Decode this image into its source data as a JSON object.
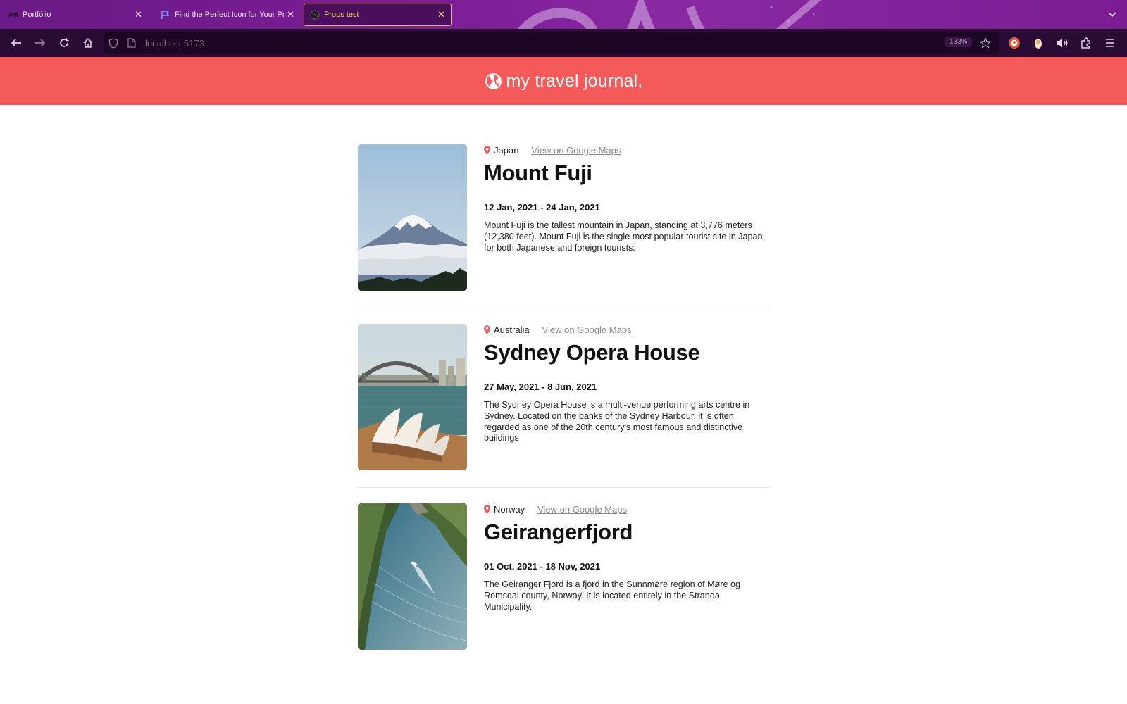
{
  "browser": {
    "tabs": [
      {
        "label": "Portfólio",
        "icon": "site-logo-icon",
        "active": false
      },
      {
        "label": "Find the Perfect Icon for Your Pr",
        "icon": "flag-icon",
        "active": false
      },
      {
        "label": "Props test",
        "icon": "globe-icon",
        "active": true
      }
    ],
    "url": {
      "host": "localhost",
      "port": ":5173"
    },
    "zoom": "133%",
    "accent": "#f6d56a"
  },
  "header": {
    "title": "my travel journal.",
    "icon": "globe-icon",
    "color": "#f55a5a"
  },
  "entries": [
    {
      "country": "Japan",
      "maps_label": "View on Google Maps",
      "title": "Mount Fuji",
      "dates": "12 Jan, 2021 - 24 Jan, 2021",
      "description": "Mount Fuji is the tallest mountain in Japan, standing at 3,776 meters (12,380 feet). Mount Fuji is the single most popular tourist site in Japan, for both Japanese and foreign tourists.",
      "image": "mount-fuji-photo"
    },
    {
      "country": "Australia",
      "maps_label": "View on Google Maps",
      "title": "Sydney Opera House",
      "dates": "27 May, 2021 - 8 Jun, 2021",
      "description": "The Sydney Opera House is a multi-venue performing arts centre in Sydney. Located on the banks of the Sydney Harbour, it is often regarded as one of the 20th century's most famous and distinctive buildings",
      "image": "sydney-opera-house-photo"
    },
    {
      "country": "Norway",
      "maps_label": "View on Google Maps",
      "title": "Geirangerfjord",
      "dates": "01 Oct, 2021 - 18 Nov, 2021",
      "description": "The Geiranger Fjord is a fjord in the Sunnmøre region of Møre og Romsdal county, Norway. It is located entirely in the Stranda Municipality.",
      "image": "geirangerfjord-photo"
    }
  ]
}
